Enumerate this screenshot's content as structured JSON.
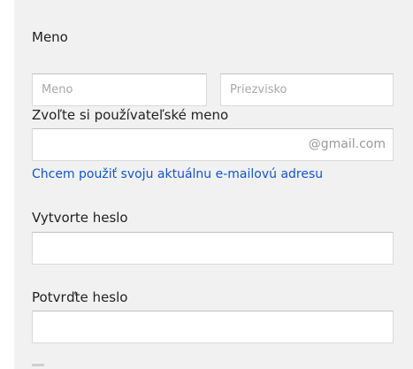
{
  "form": {
    "name": {
      "label": "Meno",
      "first_placeholder": "Meno",
      "last_placeholder": "Priezvisko"
    },
    "username": {
      "label": "Zvoľte si používateľské meno",
      "suffix": "@gmail.com",
      "value": "",
      "alt_link": "Chcem použiť svoju aktuálnu e-mailovú adresu"
    },
    "password": {
      "label": "Vytvorte heslo",
      "value": ""
    },
    "confirm_password": {
      "label": "Potvrďte heslo",
      "value": ""
    }
  }
}
